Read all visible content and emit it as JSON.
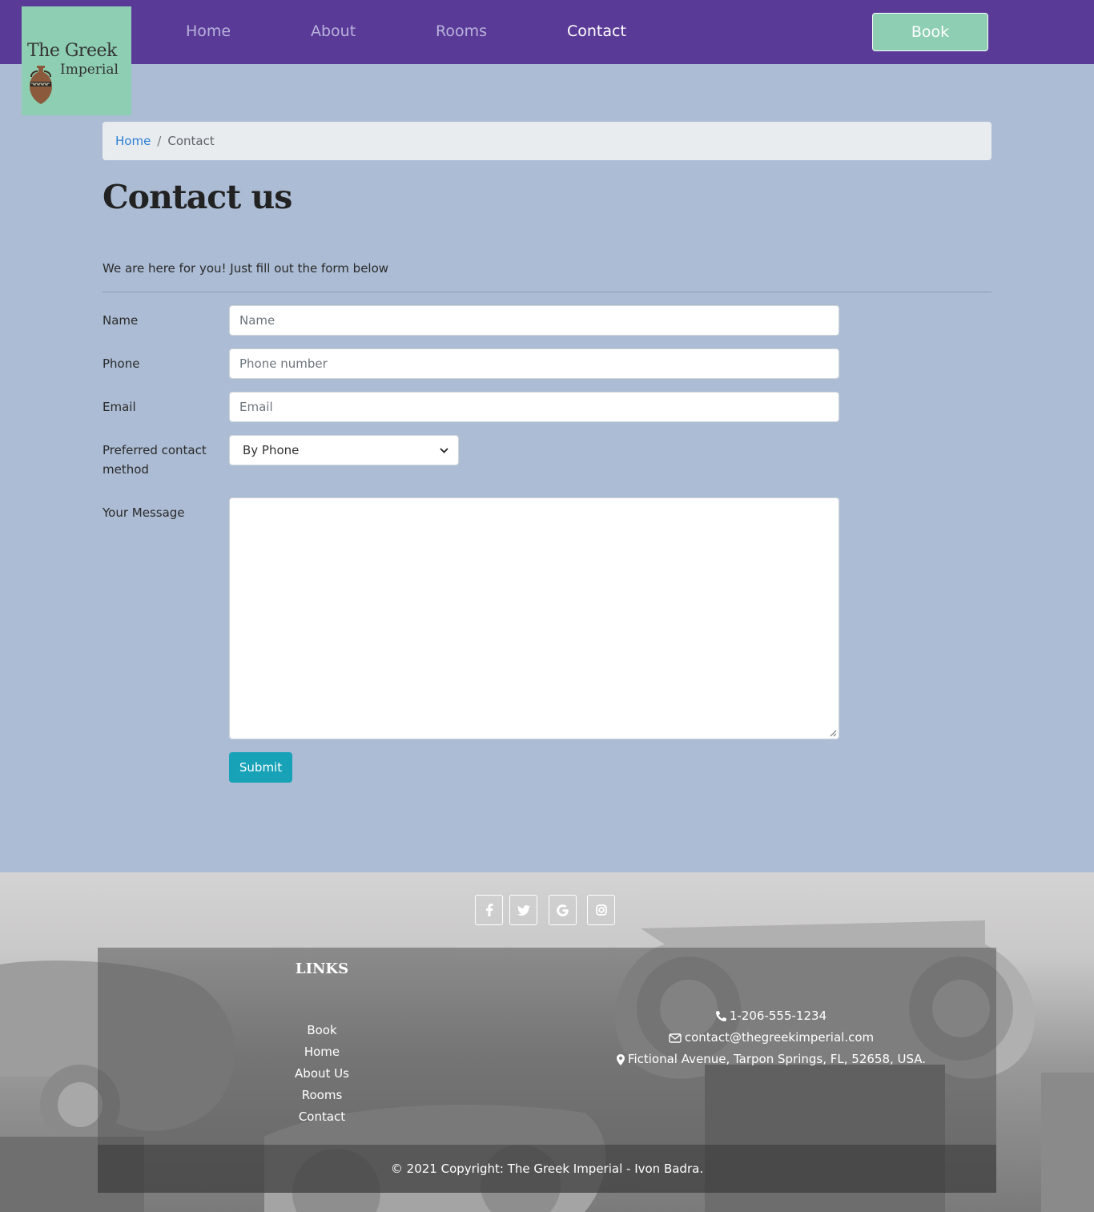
{
  "brand": {
    "line1": "The Greek",
    "line2": "Imperial"
  },
  "nav": {
    "items": [
      {
        "label": "Home"
      },
      {
        "label": "About"
      },
      {
        "label": "Rooms"
      },
      {
        "label": "Contact",
        "active": true
      }
    ],
    "book_label": "Book"
  },
  "breadcrumb": {
    "home": "Home",
    "separator": "/",
    "current": "Contact"
  },
  "page": {
    "title": "Contact us",
    "intro": "We are here for you! Just fill out the form below"
  },
  "form": {
    "name": {
      "label": "Name",
      "placeholder": "Name",
      "value": ""
    },
    "phone": {
      "label": "Phone",
      "placeholder": "Phone number",
      "value": ""
    },
    "email": {
      "label": "Email",
      "placeholder": "Email",
      "value": ""
    },
    "contact_method": {
      "label": "Preferred contact method",
      "selected": "By Phone"
    },
    "message": {
      "label": "Your Message",
      "value": ""
    },
    "submit_label": "Submit"
  },
  "footer": {
    "social": [
      {
        "icon": "facebook-icon",
        "glyph": "f"
      },
      {
        "icon": "twitter-icon",
        "glyph": "🐦"
      },
      {
        "icon": "google-icon",
        "glyph": "G"
      },
      {
        "icon": "instagram-icon",
        "glyph": "◎"
      }
    ],
    "links_title": "LINKS",
    "links": [
      "Book",
      "Home",
      "About Us",
      "Rooms",
      "Contact"
    ],
    "contact": {
      "phone": "1-206-555-1234",
      "email": "contact@thegreekimperial.com",
      "address": "Fictional Avenue, Tarpon Springs, FL, 52658, USA."
    },
    "copyright": "© 2021 Copyright: The Greek Imperial - Ivon Badra."
  },
  "colors": {
    "navbar": "#5a3a97",
    "page_bg": "#abbcd4",
    "brand_green": "#8ecfb3",
    "submit": "#17a2b8",
    "link": "#2b7fd4"
  }
}
